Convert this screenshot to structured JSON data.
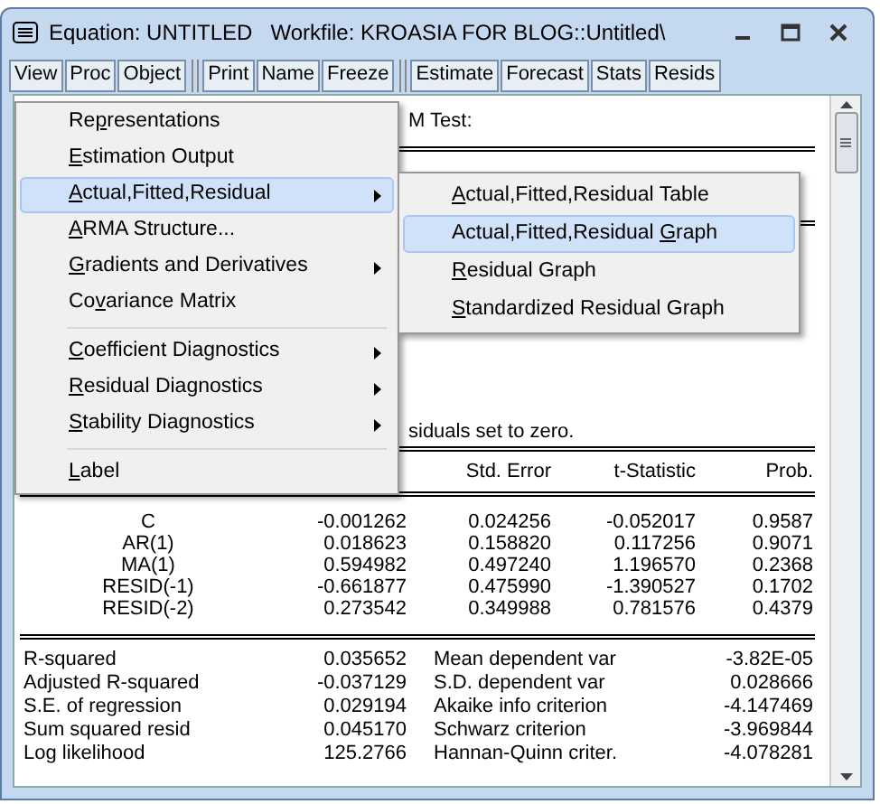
{
  "window": {
    "title": "Equation: UNTITLED   Workfile: KROASIA FOR BLOG::Untitled\\"
  },
  "toolbar": [
    {
      "label": "View",
      "separator_before": false
    },
    {
      "label": "Proc",
      "separator_before": false
    },
    {
      "label": "Object",
      "separator_before": false
    },
    {
      "label": "Print",
      "separator_before": true
    },
    {
      "label": "Name",
      "separator_before": false
    },
    {
      "label": "Freeze",
      "separator_before": false
    },
    {
      "label": "Estimate",
      "separator_before": true
    },
    {
      "label": "Forecast",
      "separator_before": false
    },
    {
      "label": "Stats",
      "separator_before": false
    },
    {
      "label": "Resids",
      "separator_before": false
    }
  ],
  "output": {
    "test_title": "M Test:",
    "note": "siduals set to zero.",
    "columns": [
      null,
      null,
      "Std. Error",
      "t-Statistic",
      "Prob."
    ],
    "rows": [
      [
        "C",
        "-0.001262",
        "0.024256",
        "-0.052017",
        "0.9587"
      ],
      [
        "AR(1)",
        "0.018623",
        "0.158820",
        "0.117256",
        "0.9071"
      ],
      [
        "MA(1)",
        "0.594982",
        "0.497240",
        "1.196570",
        "0.2368"
      ],
      [
        "RESID(-1)",
        "-0.661877",
        "0.475990",
        "-1.390527",
        "0.1702"
      ],
      [
        "RESID(-2)",
        "0.273542",
        "0.349988",
        "0.781576",
        "0.4379"
      ]
    ],
    "stats": [
      [
        "R-squared",
        "0.035652",
        "Mean dependent var",
        "-3.82E-05"
      ],
      [
        "Adjusted R-squared",
        "-0.037129",
        "S.D. dependent var",
        "0.028666"
      ],
      [
        "S.E. of regression",
        "0.029194",
        "Akaike info criterion",
        "-4.147469"
      ],
      [
        "Sum squared resid",
        "0.045170",
        "Schwarz criterion",
        "-3.969844"
      ],
      [
        "Log likelihood",
        "125.2766",
        "Hannan-Quinn criter.",
        "-4.078281"
      ]
    ]
  },
  "menu": {
    "items": [
      {
        "kind": "item",
        "pre": "Re",
        "key": "p",
        "post": "resentations",
        "selected": false,
        "submenu": false
      },
      {
        "kind": "item",
        "key": "E",
        "post": "stimation Output",
        "selected": false,
        "submenu": false
      },
      {
        "kind": "item",
        "key": "A",
        "post": "ctual,Fitted,Residual",
        "selected": true,
        "submenu": true
      },
      {
        "kind": "item",
        "key": "A",
        "post": "RMA Structure...",
        "selected": false,
        "submenu": false
      },
      {
        "kind": "item",
        "key": "G",
        "post": "radients and Derivatives",
        "selected": false,
        "submenu": true
      },
      {
        "kind": "item",
        "pre": "Co",
        "key": "v",
        "post": "ariance Matrix",
        "selected": false,
        "submenu": false
      },
      {
        "kind": "separator"
      },
      {
        "kind": "item",
        "key": "C",
        "post": "oefficient Diagnostics",
        "selected": false,
        "submenu": true
      },
      {
        "kind": "item",
        "key": "R",
        "post": "esidual Diagnostics",
        "selected": false,
        "submenu": true
      },
      {
        "kind": "item",
        "key": "S",
        "post": "tability Diagnostics",
        "selected": false,
        "submenu": true
      },
      {
        "kind": "separator"
      },
      {
        "kind": "item",
        "key": "L",
        "post": "abel",
        "selected": false,
        "submenu": false
      }
    ]
  },
  "submenu": {
    "items": [
      {
        "key": "A",
        "post": "ctual,Fitted,Residual Table",
        "selected": false
      },
      {
        "pre": "Actual,Fitted,Residual ",
        "key": "G",
        "post": "raph",
        "selected": true
      },
      {
        "key": "R",
        "post": "esidual Graph",
        "selected": false
      },
      {
        "key": "S",
        "post": "tandardized Residual Graph",
        "selected": false
      }
    ]
  }
}
